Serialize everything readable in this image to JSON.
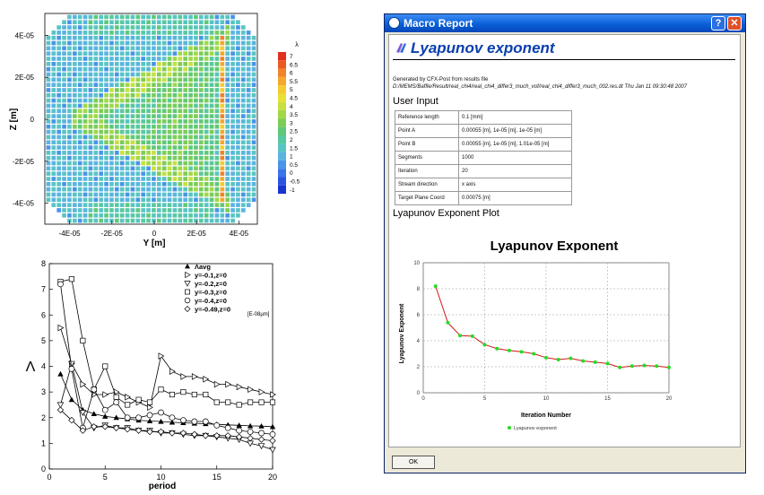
{
  "heatmap": {
    "y_ticks": [
      "4E-05",
      "2E-05",
      "0",
      "-2E-05",
      "-4E-05"
    ],
    "x_ticks": [
      "-4E-05",
      "-2E-05",
      "0",
      "2E-05",
      "4E-05"
    ],
    "xlabel": "Y [m]",
    "ylabel": "Z [m]",
    "colorbar_title": "λ",
    "colorbar_labels": [
      "7",
      "6.5",
      "6",
      "5.5",
      "5",
      "4.5",
      "4",
      "3.5",
      "3",
      "2.5",
      "2",
      "1.5",
      "1",
      "0.5",
      "0",
      "-0.5",
      "-1"
    ],
    "colorbar_colors": [
      "#e03020",
      "#ea5a22",
      "#f08428",
      "#f5a82c",
      "#f5cc30",
      "#e8e034",
      "#c8e040",
      "#a0d848",
      "#7ccc58",
      "#60c878",
      "#58c8a0",
      "#58c4c4",
      "#5ab4e0",
      "#4a94e8",
      "#3a74e8",
      "#2a54e0",
      "#1a34d0"
    ]
  },
  "chart_data": [
    {
      "type": "line",
      "xlabel": "period",
      "ylabel": "Λ",
      "xlim": [
        0,
        20
      ],
      "ylim": [
        0,
        8
      ],
      "x_ticks": [
        "0",
        "5",
        "10",
        "15",
        "20"
      ],
      "y_ticks": [
        "0",
        "1",
        "2",
        "3",
        "4",
        "5",
        "6",
        "7",
        "8"
      ],
      "unit_note": "[E-08μm]",
      "series": [
        {
          "name": "Λavg",
          "marker": "triangle-filled",
          "x": [
            1,
            2,
            3,
            4,
            5,
            6,
            7,
            8,
            9,
            10,
            11,
            12,
            13,
            14,
            15,
            16,
            17,
            18,
            19,
            20
          ],
          "y": [
            3.7,
            2.7,
            2.3,
            2.15,
            2.05,
            2.0,
            1.95,
            1.9,
            1.87,
            1.85,
            1.82,
            1.8,
            1.78,
            1.76,
            1.74,
            1.72,
            1.7,
            1.68,
            1.67,
            1.65
          ]
        },
        {
          "name": "y=-0.1,z=0",
          "marker": "triangle-right",
          "x": [
            1,
            2,
            3,
            4,
            5,
            6,
            7,
            8,
            9,
            10,
            11,
            12,
            13,
            14,
            15,
            16,
            17,
            18,
            19,
            20
          ],
          "y": [
            5.5,
            4.1,
            3.3,
            2.9,
            2.9,
            3.0,
            2.8,
            2.6,
            2.4,
            4.4,
            3.8,
            3.6,
            3.6,
            3.5,
            3.3,
            3.3,
            3.2,
            3.1,
            3.0,
            2.9
          ]
        },
        {
          "name": "y=-0.2,z=0",
          "marker": "triangle-down",
          "x": [
            1,
            2,
            3,
            4,
            5,
            6,
            7,
            8,
            9,
            10,
            11,
            12,
            13,
            14,
            15,
            16,
            17,
            18,
            19,
            20
          ],
          "y": [
            2.5,
            4.1,
            2.2,
            1.6,
            1.7,
            1.6,
            1.6,
            1.5,
            1.5,
            1.4,
            1.4,
            1.35,
            1.3,
            1.3,
            1.25,
            1.2,
            1.15,
            1.0,
            0.9,
            0.75
          ]
        },
        {
          "name": "y=-0.3,z=0",
          "marker": "square",
          "x": [
            1,
            2,
            3,
            4,
            5,
            6,
            7,
            8,
            9,
            10,
            11,
            12,
            13,
            14,
            15,
            16,
            17,
            18,
            19,
            20
          ],
          "y": [
            7.3,
            7.4,
            5.0,
            3.1,
            4.0,
            2.8,
            2.5,
            2.7,
            2.6,
            3.1,
            2.9,
            3.0,
            2.9,
            2.9,
            2.6,
            2.6,
            2.5,
            2.6,
            2.6,
            2.6
          ]
        },
        {
          "name": "y=-0.4,z=0",
          "marker": "circle",
          "x": [
            1,
            2,
            3,
            4,
            5,
            6,
            7,
            8,
            9,
            10,
            11,
            12,
            13,
            14,
            15,
            16,
            17,
            18,
            19,
            20
          ],
          "y": [
            7.2,
            3.9,
            1.6,
            3.1,
            2.3,
            2.6,
            2.0,
            2.0,
            2.1,
            2.2,
            2.0,
            1.9,
            1.85,
            1.85,
            1.7,
            1.6,
            1.5,
            1.45,
            1.4,
            1.35
          ]
        },
        {
          "name": "y=-0.49,z=0",
          "marker": "diamond",
          "x": [
            1,
            2,
            3,
            4,
            5,
            6,
            7,
            8,
            9,
            10,
            11,
            12,
            13,
            14,
            15,
            16,
            17,
            18,
            19,
            20
          ],
          "y": [
            2.3,
            1.9,
            1.5,
            1.65,
            1.65,
            1.6,
            1.55,
            1.5,
            1.45,
            1.45,
            1.4,
            1.4,
            1.35,
            1.3,
            1.3,
            1.3,
            1.25,
            1.2,
            1.15,
            1.1
          ]
        }
      ]
    },
    {
      "type": "line",
      "title": "Lyapunov Exponent",
      "xlabel": "Iteration Number",
      "ylabel": "Lyapunov Exponent",
      "xlim": [
        0,
        20
      ],
      "ylim": [
        0,
        10
      ],
      "x_ticks": [
        "0",
        "5",
        "10",
        "15",
        "20"
      ],
      "y_ticks": [
        "0",
        "2",
        "4",
        "6",
        "8",
        "10"
      ],
      "grid": true,
      "legend": "bottom",
      "line_color": "#d01818",
      "marker_color": "#22dd22",
      "series": [
        {
          "name": "Lyapunov exponent",
          "x": [
            1,
            2,
            3,
            4,
            5,
            6,
            7,
            8,
            9,
            10,
            11,
            12,
            13,
            14,
            15,
            16,
            17,
            18,
            19,
            20
          ],
          "y": [
            8.2,
            5.4,
            4.4,
            4.35,
            3.7,
            3.4,
            3.25,
            3.15,
            3.0,
            2.7,
            2.55,
            2.65,
            2.45,
            2.35,
            2.25,
            1.95,
            2.05,
            2.1,
            2.05,
            1.95
          ]
        }
      ]
    }
  ],
  "window": {
    "title": "Macro Report",
    "help_button": "?",
    "close_button": "✕",
    "report_title": "Lyapunov exponent",
    "generated_line1": "Generated by CFX-Post from results file",
    "generated_line2": "D:/MEMS/Baffle/Result/real_chi4/real_chi4_differ3_much_vof/real_chi4_differ3_much_002.res.dt  Thu Jan 11 09:30:48 2007",
    "user_input_heading": "User Input",
    "inputs": [
      {
        "key": "Reference length",
        "value": "0.1 [mm]"
      },
      {
        "key": "Point A",
        "value": "0.00055 [m], 1e-05 [m], 1e-05 [m]"
      },
      {
        "key": "Point B",
        "value": "0.00055 [m], 1e-05 [m], 1.01e-05 [m]"
      },
      {
        "key": "Segments",
        "value": "1000"
      },
      {
        "key": "Iteration",
        "value": "20"
      },
      {
        "key": "Stream direction",
        "value": "x axis"
      },
      {
        "key": "Target Plane Coord",
        "value": "0.00075 [m]"
      }
    ],
    "plot_heading": "Lyapunov Exponent Plot",
    "ok_button": "OK"
  }
}
